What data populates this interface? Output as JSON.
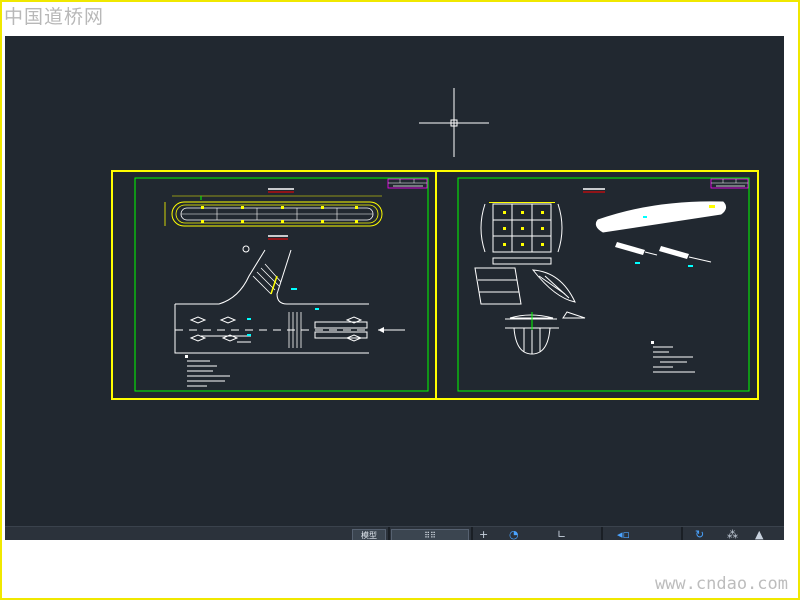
{
  "watermark": {
    "site_name": "中国道桥网",
    "site_url": "www.cndao.com"
  },
  "colors": {
    "canvas": "#212830",
    "sheet_border": "#ffff00",
    "inner_frame": "#00ff00",
    "linework": "#ffffff",
    "accent_yellow": "#ffff00",
    "accent_magenta": "#ff00ff",
    "accent_red": "#ff0000",
    "accent_cyan": "#00ffff"
  },
  "statusbar": {
    "model_tab": "模型",
    "grid_glyph": "⠿⠿",
    "icons": [
      "snap-icon",
      "polar-icon",
      "osnap-icon",
      "workspace-icon",
      "annotation-icon"
    ]
  }
}
